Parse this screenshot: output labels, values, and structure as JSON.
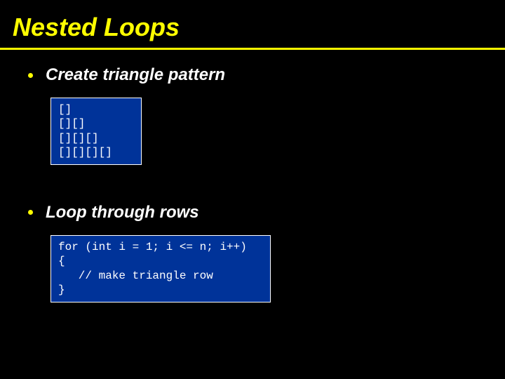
{
  "title": "Nested Loops",
  "bullets": {
    "b1": "Create triangle pattern",
    "b2": "Loop through rows"
  },
  "code": {
    "triangle": "[]\n[][]\n[][][]\n[][][][]",
    "loop": "for (int i = 1; i <= n; i++)\n{\n   // make triangle row\n}"
  }
}
